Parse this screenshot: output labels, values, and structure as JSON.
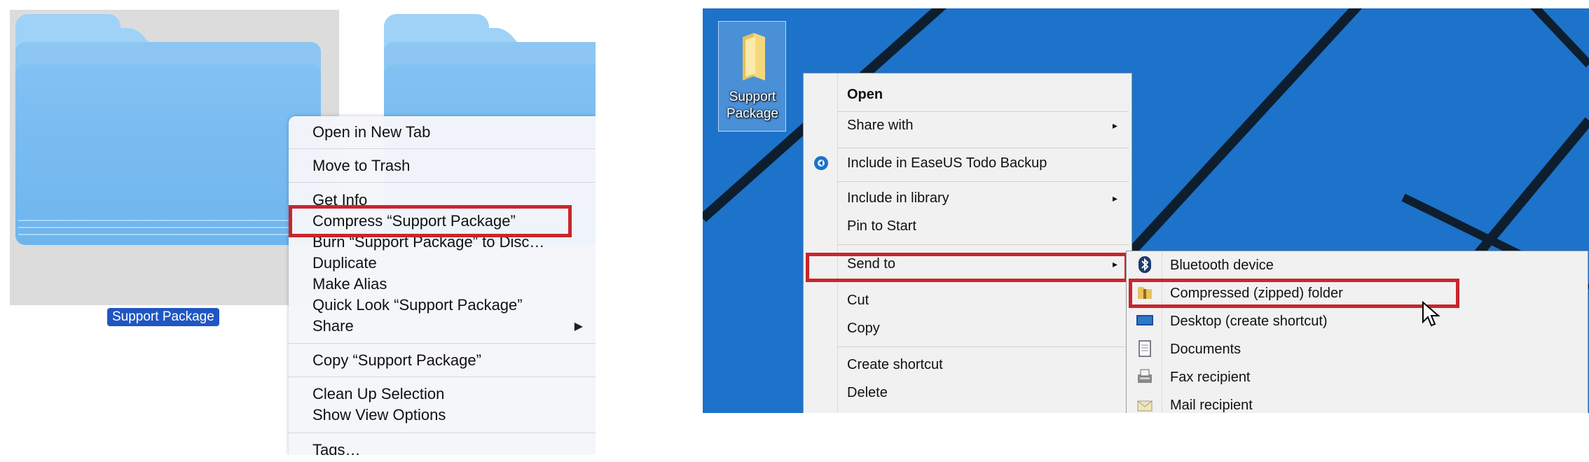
{
  "mac": {
    "folder_label": "Support Package",
    "menu_items": [
      {
        "label": "Open in New Tab"
      },
      {
        "label": "Move to Trash"
      },
      {
        "label": "Get Info"
      },
      {
        "label": "Compress “Support Package”"
      },
      {
        "label": "Burn “Support Package” to Disc…"
      },
      {
        "label": "Duplicate"
      },
      {
        "label": "Make Alias"
      },
      {
        "label": "Quick Look “Support Package”"
      },
      {
        "label": "Share"
      },
      {
        "label": "Copy “Support Package”"
      },
      {
        "label": "Clean Up Selection"
      },
      {
        "label": "Show View Options"
      },
      {
        "label": "Tags…"
      }
    ],
    "arrow": "▶",
    "highlighted_item": "Compress “Support Package”",
    "highlight_color": "#c8262c"
  },
  "win": {
    "icon_label_line1": "Support",
    "icon_label_line2": "Package",
    "menu_items": [
      {
        "label": "Open"
      },
      {
        "label": "Share with"
      },
      {
        "label": "Include in EaseUS Todo Backup"
      },
      {
        "label": "Include in library"
      },
      {
        "label": "Pin to Start"
      },
      {
        "label": "Send to"
      },
      {
        "label": "Cut"
      },
      {
        "label": "Copy"
      },
      {
        "label": "Create shortcut"
      },
      {
        "label": "Delete"
      }
    ],
    "submenu_items": [
      {
        "label": "Bluetooth device"
      },
      {
        "label": "Compressed (zipped) folder"
      },
      {
        "label": "Desktop (create shortcut)"
      },
      {
        "label": "Documents"
      },
      {
        "label": "Fax recipient"
      },
      {
        "label": "Mail recipient"
      }
    ],
    "arrow": "▸",
    "highlighted_items": [
      "Send to",
      "Compressed (zipped) folder"
    ],
    "desktop_color": "#1d72c9"
  }
}
